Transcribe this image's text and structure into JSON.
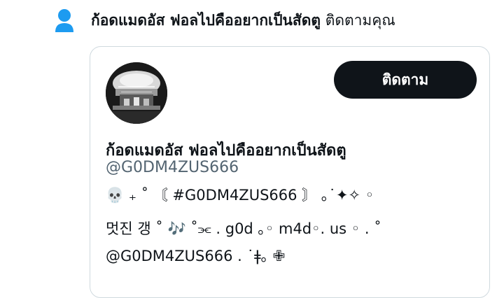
{
  "notification": {
    "icon": "person-icon",
    "accent": "#1d9bf0",
    "name": "ก้อดแมดอัส ฟอลไปคืออยากเป็นสัดตู",
    "action": "ติดตามคุณ"
  },
  "profile_card": {
    "avatar": "profile-avatar",
    "follow_button": "ติดตาม",
    "display_name": "ก้อดแมดอัส ฟอลไปคืออยากเป็นสัดตู",
    "handle": "@G0DM4ZUS666",
    "bio_lines": [
      "💀 ₊ ˚ 〘 #G0DM4ZUS666 〙 ｡˙✦✧ ◦",
      "멋진 갱 ˚ 🎶 ˚⫘ . g0d ｡◦ m4d◦. us ◦ . ˚",
      "@G0DM4ZUS666 . ˙ǂ｡ ✙"
    ]
  }
}
